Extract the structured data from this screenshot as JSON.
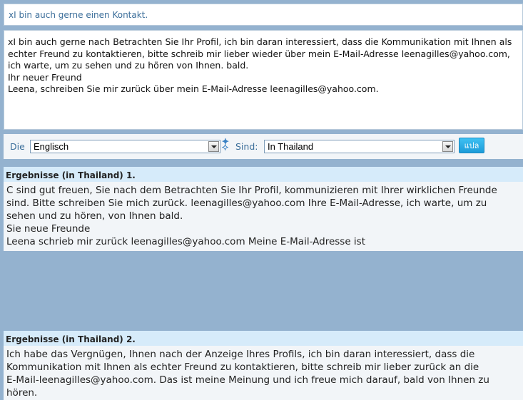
{
  "subject": "xI bin auch gerne einen Kontakt.",
  "source_text": "xI bin auch gerne nach Betrachten Sie Ihr Profil, ich bin daran interessiert, dass die Kommunikation mit Ihnen als\nechter Freund zu kontaktieren, bitte schreib mir lieber wieder über mein E-Mail-Adresse leenagilles@yahoo.com,\nich warte, um zu sehen und zu hören von Ihnen. bald.\nIhr neuer Freund\nLeena, schreiben Sie mir zurück über mein E-Mail-Adresse leenagilles@yahoo.com.",
  "toolbar": {
    "from_label": "Die",
    "from_value": "Englisch",
    "to_label": "Sind:",
    "to_value": "In Thailand",
    "go_label": "แปล"
  },
  "results": [
    {
      "heading": "Ergebnisse (in Thailand) 1.",
      "text": "C sind gut freuen, Sie nach dem Betrachten Sie Ihr Profil, kommunizieren mit Ihrer wirklichen Freunde\nsind. Bitte schreiben Sie mich zurück. leenagilles@yahoo.com Ihre E-Mail-Adresse, ich warte, um zu\nsehen und zu hören, von Ihnen bald.\nSie neue Freunde\nLeena schrieb mir zurück leenagilles@yahoo.com Meine E-Mail-Adresse ist"
    },
    {
      "heading": "Ergebnisse (in Thailand) 2.",
      "text": "Ich habe das Vergnügen, Ihnen nach der Anzeige Ihres Profils, ich bin daran interessiert, dass die\nKommunikation mit Ihnen als echter Freund zu kontaktieren, bitte schreib mir lieber zurück an die\nE-Mail-leenagilles@yahoo.com. Das ist meine Meinung und ich freue mich darauf, bald von Ihnen zu\nhören."
    }
  ],
  "colors": {
    "page_background": "#94b2cf",
    "accent_text": "#3b6e9a",
    "result_header": "#d6ebfa",
    "button": "#1c9bd9"
  },
  "icons": {
    "swap": "swap-arrows-icon",
    "dropdown": "chevron-down-icon"
  }
}
